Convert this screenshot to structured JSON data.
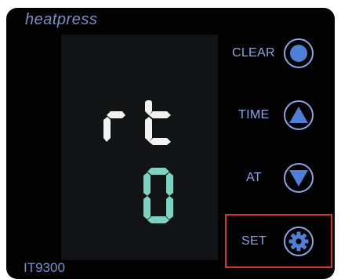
{
  "brand": "heatpress",
  "model": "IT9300",
  "display": {
    "line1": "rt",
    "line2": "0",
    "line1_color": "#f2f2f2",
    "line2_color": "#7ed3c0"
  },
  "buttons": {
    "clear": {
      "label": "CLEAR",
      "icon": "circle-icon"
    },
    "time": {
      "label": "TIME",
      "icon": "triangle-up-icon"
    },
    "at": {
      "label": "AT",
      "icon": "triangle-down-icon"
    },
    "set": {
      "label": "SET",
      "icon": "gear-icon",
      "highlighted": true
    }
  },
  "colors": {
    "accent": "#8aa4e4",
    "icon_fill": "#4f7fd6",
    "highlight": "#d9322a",
    "panel": "#020202",
    "screen": "#121314"
  }
}
